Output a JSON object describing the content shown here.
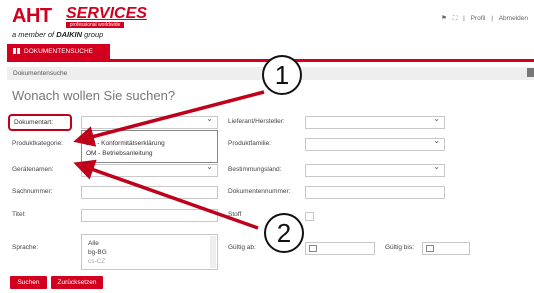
{
  "header": {
    "brand": "AHT",
    "services": "SERVICES",
    "services_sub": "professional worldwide",
    "member_prefix": "a member of",
    "member_brand": "DAIKIN",
    "member_suffix": "group",
    "top_links": [
      "Profil",
      "Abmelden"
    ]
  },
  "tab": {
    "label": "DOKUMENTENSUCHE"
  },
  "breadcrumb": "Dokumentensuche",
  "page_title": "Wonach wollen Sie suchen?",
  "form": {
    "left_labels": {
      "dokumentart": "Dokumentart:",
      "produktkategorie": "Produktkategorie:",
      "geraetenamen": "Gerätenamen:",
      "sachnummer": "Sachnummer:",
      "titel": "Titel:",
      "sprache": "Sprache:"
    },
    "right_labels": {
      "lieferant": "Lieferant/Hersteller:",
      "produktfamilie": "Produktfamilie:",
      "bestimmungsland": "Bestimmungsland:",
      "dokumentennummer": "Dokumentennummer:",
      "stoff": "Stoff",
      "gueltig_ab": "Gültig ab:",
      "gueltig_bis": "Gültig bis:"
    },
    "dokumentart_options": [
      "DC - Konformitätserklärung",
      "OM - Betriebsanleitung"
    ],
    "sprache_options": [
      "Alle",
      "bg-BG",
      "cs-CZ"
    ]
  },
  "buttons": {
    "search": "Suchen",
    "reset": "Zurücksetzen"
  },
  "callouts": [
    "1",
    "2"
  ],
  "colors": {
    "brand_red": "#d2001e",
    "highlight_red": "#c0001a"
  }
}
